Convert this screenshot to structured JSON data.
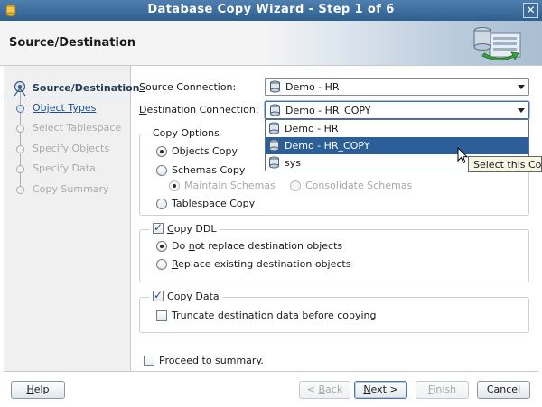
{
  "window": {
    "title": "Database Copy Wizard - Step 1 of 6",
    "close_glyph": "✕"
  },
  "header": {
    "title": "Source/Destination"
  },
  "train": {
    "steps": [
      {
        "label": "Source/Destination",
        "state": "current"
      },
      {
        "label": "Object Types",
        "state": "link"
      },
      {
        "label": "Select Tablespace",
        "state": "disabled"
      },
      {
        "label": "Specify Objects",
        "state": "disabled"
      },
      {
        "label": "Specify Data",
        "state": "disabled"
      },
      {
        "label": "Copy Summary",
        "state": "disabled"
      }
    ]
  },
  "form": {
    "source_label_pre": "",
    "source_label_mn": "S",
    "source_label_post": "ource Connection:",
    "source_value": "Demo - HR",
    "dest_label_pre": "",
    "dest_label_mn": "D",
    "dest_label_post": "estination Connection:",
    "dest_value": "Demo - HR_COPY",
    "dropdown": {
      "options": [
        "Demo - HR",
        "Demo - HR_COPY",
        "sys"
      ],
      "selected": "Demo - HR_COPY"
    },
    "tooltip": "Select this Connection",
    "copy_options": {
      "title": "Copy Options",
      "objects_copy": "Objects Copy",
      "schemas_copy": "Schemas Copy",
      "maintain_schemas": "Maintain Schemas",
      "consolidate_schemas": "Consolidate Schemas",
      "tablespace_copy": "Tablespace Copy"
    },
    "copy_ddl": {
      "title_mn": "C",
      "title_post": "opy DDL",
      "no_replace_pre": "Do ",
      "no_replace_mn": "n",
      "no_replace_post": "ot replace destination objects",
      "replace_mn": "R",
      "replace_post": "eplace existing destination objects"
    },
    "copy_data": {
      "title_mn": "C",
      "title_post": "opy Data",
      "truncate": "Truncate destination data before copying"
    },
    "proceed": "Proceed to summary."
  },
  "buttons": {
    "help_mn": "H",
    "help_post": "elp",
    "back_pre": "< ",
    "back_mn": "B",
    "back_post": "ack",
    "next_mn": "N",
    "next_post": "ext >",
    "finish_mn": "F",
    "finish_post": "inish",
    "cancel": "Cancel"
  },
  "colors": {
    "titlebar": "#3a6a9b",
    "selection": "#2c5f97",
    "link": "#1b4f9c"
  }
}
